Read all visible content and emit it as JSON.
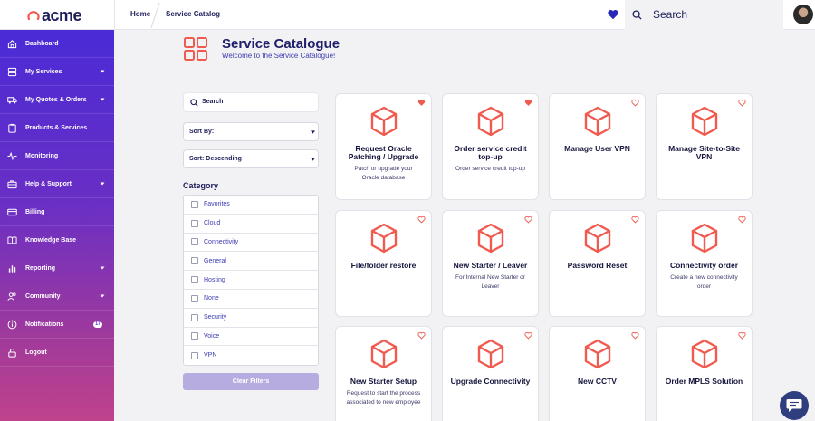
{
  "brand": {
    "name": "acme",
    "accent": "#f05a4f",
    "primary": "#1e1e5a"
  },
  "breadcrumb": {
    "home": "Home",
    "current": "Service Catalog"
  },
  "topbar": {
    "search_placeholder": "Search"
  },
  "sidebar": {
    "items": [
      {
        "label": "Dashboard",
        "icon": "home-icon",
        "chevron": false
      },
      {
        "label": "My Services",
        "icon": "server-icon",
        "chevron": true
      },
      {
        "label": "My Quotes & Orders",
        "icon": "truck-icon",
        "chevron": true
      },
      {
        "label": "Products & Services",
        "icon": "clipboard-icon",
        "chevron": false
      },
      {
        "label": "Monitoring",
        "icon": "pulse-icon",
        "chevron": false
      },
      {
        "label": "Help & Support",
        "icon": "briefcase-icon",
        "chevron": true
      },
      {
        "label": "Billing",
        "icon": "credit-card-icon",
        "chevron": false
      },
      {
        "label": "Knowledge Base",
        "icon": "book-icon",
        "chevron": false
      },
      {
        "label": "Reporting",
        "icon": "bar-chart-icon",
        "chevron": true
      },
      {
        "label": "Community",
        "icon": "users-icon",
        "chevron": true
      },
      {
        "label": "Notifications",
        "icon": "info-icon",
        "chevron": false,
        "badge": "17"
      },
      {
        "label": "Logout",
        "icon": "lock-icon",
        "chevron": false
      }
    ]
  },
  "header": {
    "title": "Service Catalogue",
    "subtitle": "Welcome to the Service Catalogue!"
  },
  "filters": {
    "search_placeholder": "Search",
    "sort_by": "Sort By:",
    "sort_order": "Sort: Descending",
    "category_title": "Category",
    "categories": [
      "Favorites",
      "Cloud",
      "Connectivity",
      "General",
      "Hosting",
      "None",
      "Security",
      "Voice",
      "VPN"
    ],
    "clear_label": "Clear Filters"
  },
  "cards": [
    {
      "title": "Request Oracle Patching / Upgrade",
      "desc": "Patch or upgrade your Oracle database",
      "favorite": true
    },
    {
      "title": "Order service credit top-up",
      "desc": "Order service credit top-up",
      "favorite": true
    },
    {
      "title": "Manage User VPN",
      "desc": "",
      "favorite": false
    },
    {
      "title": "Manage Site-to-Site VPN",
      "desc": "",
      "favorite": false
    },
    {
      "title": "File/folder restore",
      "desc": "",
      "favorite": false
    },
    {
      "title": "New Starter / Leaver",
      "desc": "For Internal New Starter or Leaver",
      "favorite": false
    },
    {
      "title": "Password Reset",
      "desc": "",
      "favorite": false
    },
    {
      "title": "Connectivity order",
      "desc": "Create a new connectivity order",
      "favorite": false
    },
    {
      "title": "New Starter Setup",
      "desc": "Request to start the process associated to new employee",
      "favorite": false
    },
    {
      "title": "Upgrade Connectivity",
      "desc": "",
      "favorite": false
    },
    {
      "title": "New CCTV",
      "desc": "",
      "favorite": false
    },
    {
      "title": "Order MPLS Solution",
      "desc": "",
      "favorite": false
    }
  ]
}
